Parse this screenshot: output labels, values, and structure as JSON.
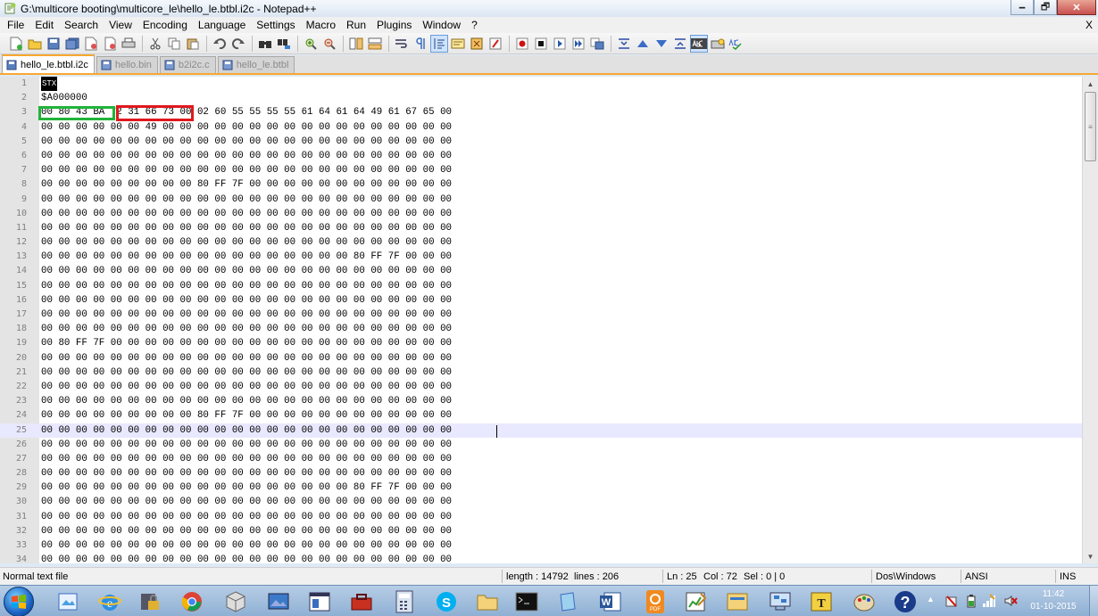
{
  "window": {
    "title": "G:\\multicore booting\\multicore_le\\hello_le.btbl.i2c - Notepad++",
    "min_label": "🗕",
    "max_label": "🗗",
    "close_label": "✕"
  },
  "menu": {
    "items": [
      "File",
      "Edit",
      "Search",
      "View",
      "Encoding",
      "Language",
      "Settings",
      "Macro",
      "Run",
      "Plugins",
      "Window",
      "?"
    ],
    "close_label": "X"
  },
  "tabs": [
    {
      "label": "hello_le.btbl.i2c",
      "active": true
    },
    {
      "label": "hello.bin",
      "active": false
    },
    {
      "label": "b2i2c.c",
      "active": false
    },
    {
      "label": "hello_le.btbl",
      "active": false
    }
  ],
  "editor": {
    "current_line": 25,
    "lines": [
      {
        "n": "1",
        "text": "STX"
      },
      {
        "n": "2",
        "text": "$A000000"
      },
      {
        "n": "3",
        "text": "00 80 43 BA 72 31 66 73 00 02 60 55 55 55 55 61 64 61 64 49 61 67 65 00"
      },
      {
        "n": "4",
        "text": "00 00 00 00 00 00 49 00 00 00 00 00 00 00 00 00 00 00 00 00 00 00 00 00"
      },
      {
        "n": "5",
        "text": "00 00 00 00 00 00 00 00 00 00 00 00 00 00 00 00 00 00 00 00 00 00 00 00"
      },
      {
        "n": "6",
        "text": "00 00 00 00 00 00 00 00 00 00 00 00 00 00 00 00 00 00 00 00 00 00 00 00"
      },
      {
        "n": "7",
        "text": "00 00 00 00 00 00 00 00 00 00 00 00 00 00 00 00 00 00 00 00 00 00 00 00"
      },
      {
        "n": "8",
        "text": "00 00 00 00 00 00 00 00 00 80 FF 7F 00 00 00 00 00 00 00 00 00 00 00 00"
      },
      {
        "n": "9",
        "text": "00 00 00 00 00 00 00 00 00 00 00 00 00 00 00 00 00 00 00 00 00 00 00 00"
      },
      {
        "n": "10",
        "text": "00 00 00 00 00 00 00 00 00 00 00 00 00 00 00 00 00 00 00 00 00 00 00 00"
      },
      {
        "n": "11",
        "text": "00 00 00 00 00 00 00 00 00 00 00 00 00 00 00 00 00 00 00 00 00 00 00 00"
      },
      {
        "n": "12",
        "text": "00 00 00 00 00 00 00 00 00 00 00 00 00 00 00 00 00 00 00 00 00 00 00 00"
      },
      {
        "n": "13",
        "text": "00 00 00 00 00 00 00 00 00 00 00 00 00 00 00 00 00 00 80 FF 7F 00 00 00"
      },
      {
        "n": "14",
        "text": "00 00 00 00 00 00 00 00 00 00 00 00 00 00 00 00 00 00 00 00 00 00 00 00"
      },
      {
        "n": "15",
        "text": "00 00 00 00 00 00 00 00 00 00 00 00 00 00 00 00 00 00 00 00 00 00 00 00"
      },
      {
        "n": "16",
        "text": "00 00 00 00 00 00 00 00 00 00 00 00 00 00 00 00 00 00 00 00 00 00 00 00"
      },
      {
        "n": "17",
        "text": "00 00 00 00 00 00 00 00 00 00 00 00 00 00 00 00 00 00 00 00 00 00 00 00"
      },
      {
        "n": "18",
        "text": "00 00 00 00 00 00 00 00 00 00 00 00 00 00 00 00 00 00 00 00 00 00 00 00"
      },
      {
        "n": "19",
        "text": "00 80 FF 7F 00 00 00 00 00 00 00 00 00 00 00 00 00 00 00 00 00 00 00 00"
      },
      {
        "n": "20",
        "text": "00 00 00 00 00 00 00 00 00 00 00 00 00 00 00 00 00 00 00 00 00 00 00 00"
      },
      {
        "n": "21",
        "text": "00 00 00 00 00 00 00 00 00 00 00 00 00 00 00 00 00 00 00 00 00 00 00 00"
      },
      {
        "n": "22",
        "text": "00 00 00 00 00 00 00 00 00 00 00 00 00 00 00 00 00 00 00 00 00 00 00 00"
      },
      {
        "n": "23",
        "text": "00 00 00 00 00 00 00 00 00 00 00 00 00 00 00 00 00 00 00 00 00 00 00 00"
      },
      {
        "n": "24",
        "text": "00 00 00 00 00 00 00 00 00 80 FF 7F 00 00 00 00 00 00 00 00 00 00 00 00"
      },
      {
        "n": "25",
        "text": "00 00 00 00 00 00 00 00 00 00 00 00 00 00 00 00 00 00 00 00 00 00 00 00"
      },
      {
        "n": "26",
        "text": "00 00 00 00 00 00 00 00 00 00 00 00 00 00 00 00 00 00 00 00 00 00 00 00"
      },
      {
        "n": "27",
        "text": "00 00 00 00 00 00 00 00 00 00 00 00 00 00 00 00 00 00 00 00 00 00 00 00"
      },
      {
        "n": "28",
        "text": "00 00 00 00 00 00 00 00 00 00 00 00 00 00 00 00 00 00 00 00 00 00 00 00"
      },
      {
        "n": "29",
        "text": "00 00 00 00 00 00 00 00 00 00 00 00 00 00 00 00 00 00 80 FF 7F 00 00 00"
      },
      {
        "n": "30",
        "text": "00 00 00 00 00 00 00 00 00 00 00 00 00 00 00 00 00 00 00 00 00 00 00 00"
      },
      {
        "n": "31",
        "text": "00 00 00 00 00 00 00 00 00 00 00 00 00 00 00 00 00 00 00 00 00 00 00 00"
      },
      {
        "n": "32",
        "text": "00 00 00 00 00 00 00 00 00 00 00 00 00 00 00 00 00 00 00 00 00 00 00 00"
      },
      {
        "n": "33",
        "text": "00 00 00 00 00 00 00 00 00 00 00 00 00 00 00 00 00 00 00 00 00 00 00 00"
      },
      {
        "n": "34",
        "text": "00 00 00 00 00 00 00 00 00 00 00 00 00 00 00 00 00 00 00 00 00 00 00 00"
      }
    ]
  },
  "status": {
    "file_type": "Normal text file",
    "length": "length : 14792",
    "lines": "lines : 206",
    "ln": "Ln : 25",
    "col": "Col : 72",
    "sel": "Sel : 0 | 0",
    "eol": "Dos\\Windows",
    "encoding": "ANSI",
    "mode": "INS"
  },
  "taskbar": {
    "clock_time": "11:42",
    "clock_date": "01-10-2015",
    "pdf_label": "PDF"
  },
  "colors": {
    "highlight_green": "#22b33a",
    "highlight_red": "#e0181e",
    "tab_accent": "#f8a830",
    "current_line": "#e8e8ff"
  },
  "icons": {
    "toolbar": [
      "new-file-icon",
      "open-file-icon",
      "save-icon",
      "save-all-icon",
      "close-icon",
      "close-all-icon",
      "print-icon",
      "cut-icon",
      "copy-icon",
      "paste-icon",
      "undo-icon",
      "redo-icon",
      "find-icon",
      "replace-icon",
      "zoom-in-icon",
      "zoom-out-icon",
      "sync-v-icon",
      "sync-h-icon",
      "wrap-icon",
      "show-all-chars-icon",
      "indent-guide-icon",
      "udl-icon",
      "doc-map-icon",
      "function-list-icon",
      "record-macro-icon",
      "stop-macro-icon",
      "play-macro-icon",
      "run-macro-multiple-icon",
      "save-macro-icon",
      "compare-icon",
      "prev-diff-icon",
      "next-diff-icon",
      "last-diff-icon",
      "spell-check-icon",
      "spell-options-icon",
      "abc-check-icon"
    ]
  }
}
